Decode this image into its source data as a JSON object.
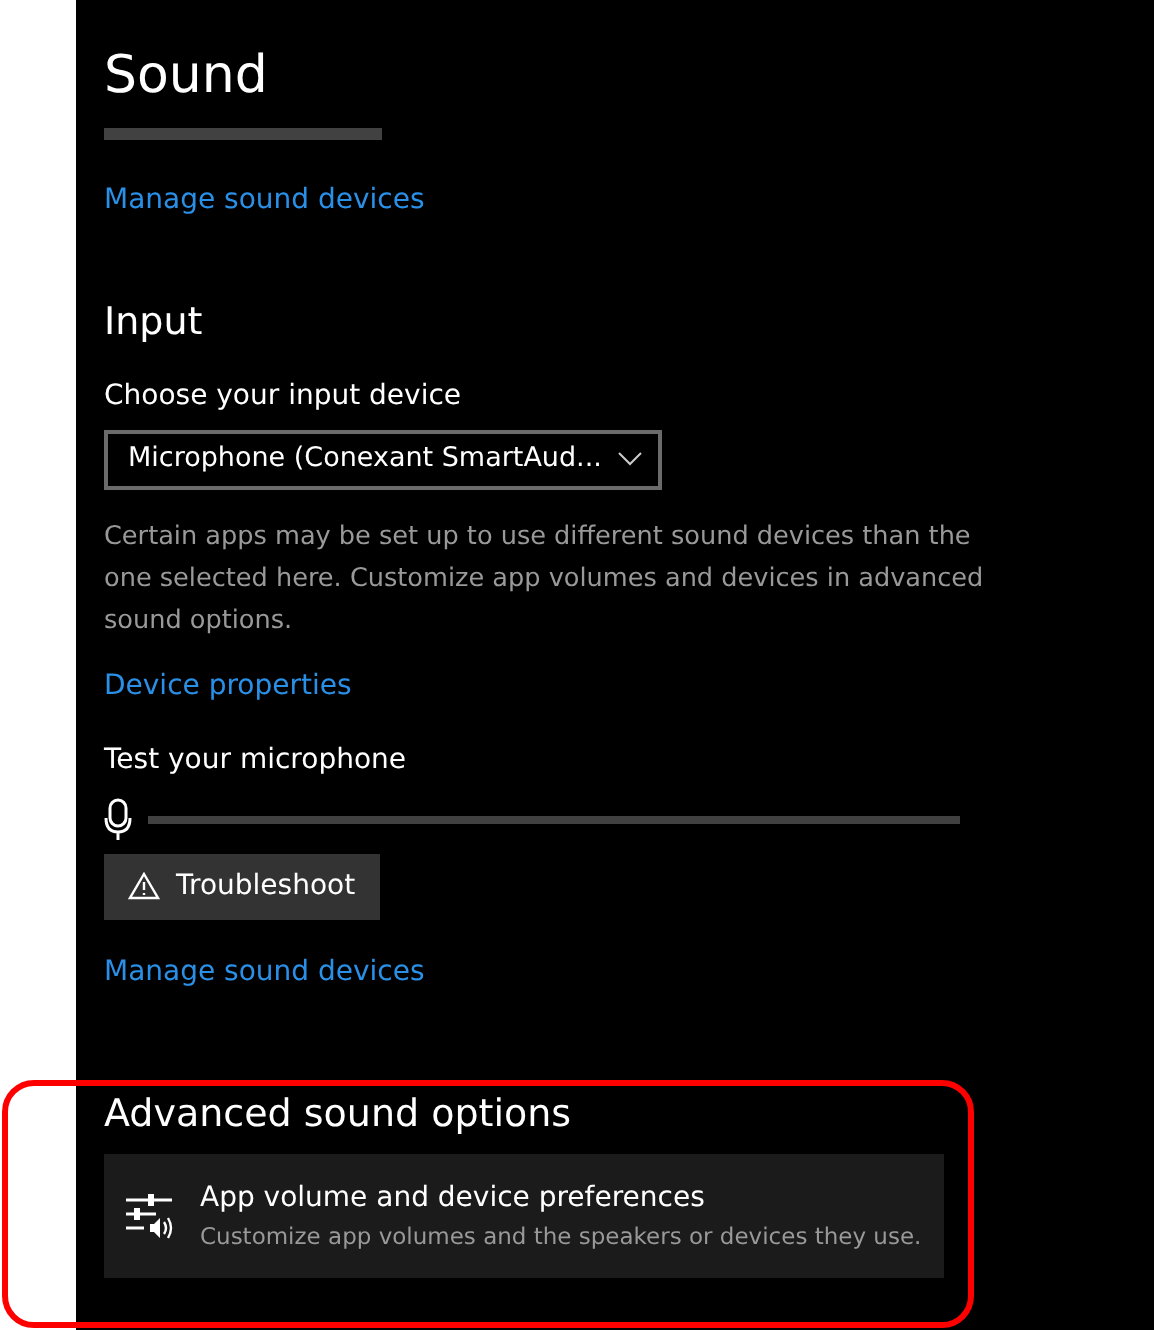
{
  "page": {
    "title": "Sound",
    "top_link": "Manage sound devices"
  },
  "input": {
    "heading": "Input",
    "device_label": "Choose your input device",
    "device_value": "Microphone (Conexant SmartAud...",
    "description": "Certain apps may be set up to use different sound devices than the one selected here. Customize app volumes and devices in advanced sound options.",
    "properties_link": "Device properties",
    "test_label": "Test your microphone",
    "mic_meter": {
      "level": 0
    },
    "troubleshoot_button": "Troubleshoot",
    "manage_link": "Manage sound devices"
  },
  "advanced": {
    "heading": "Advanced sound options",
    "item": {
      "title": "App volume and device preferences",
      "subtitle": "Customize app volumes and the speakers or devices they use."
    },
    "highlighted": true
  }
}
